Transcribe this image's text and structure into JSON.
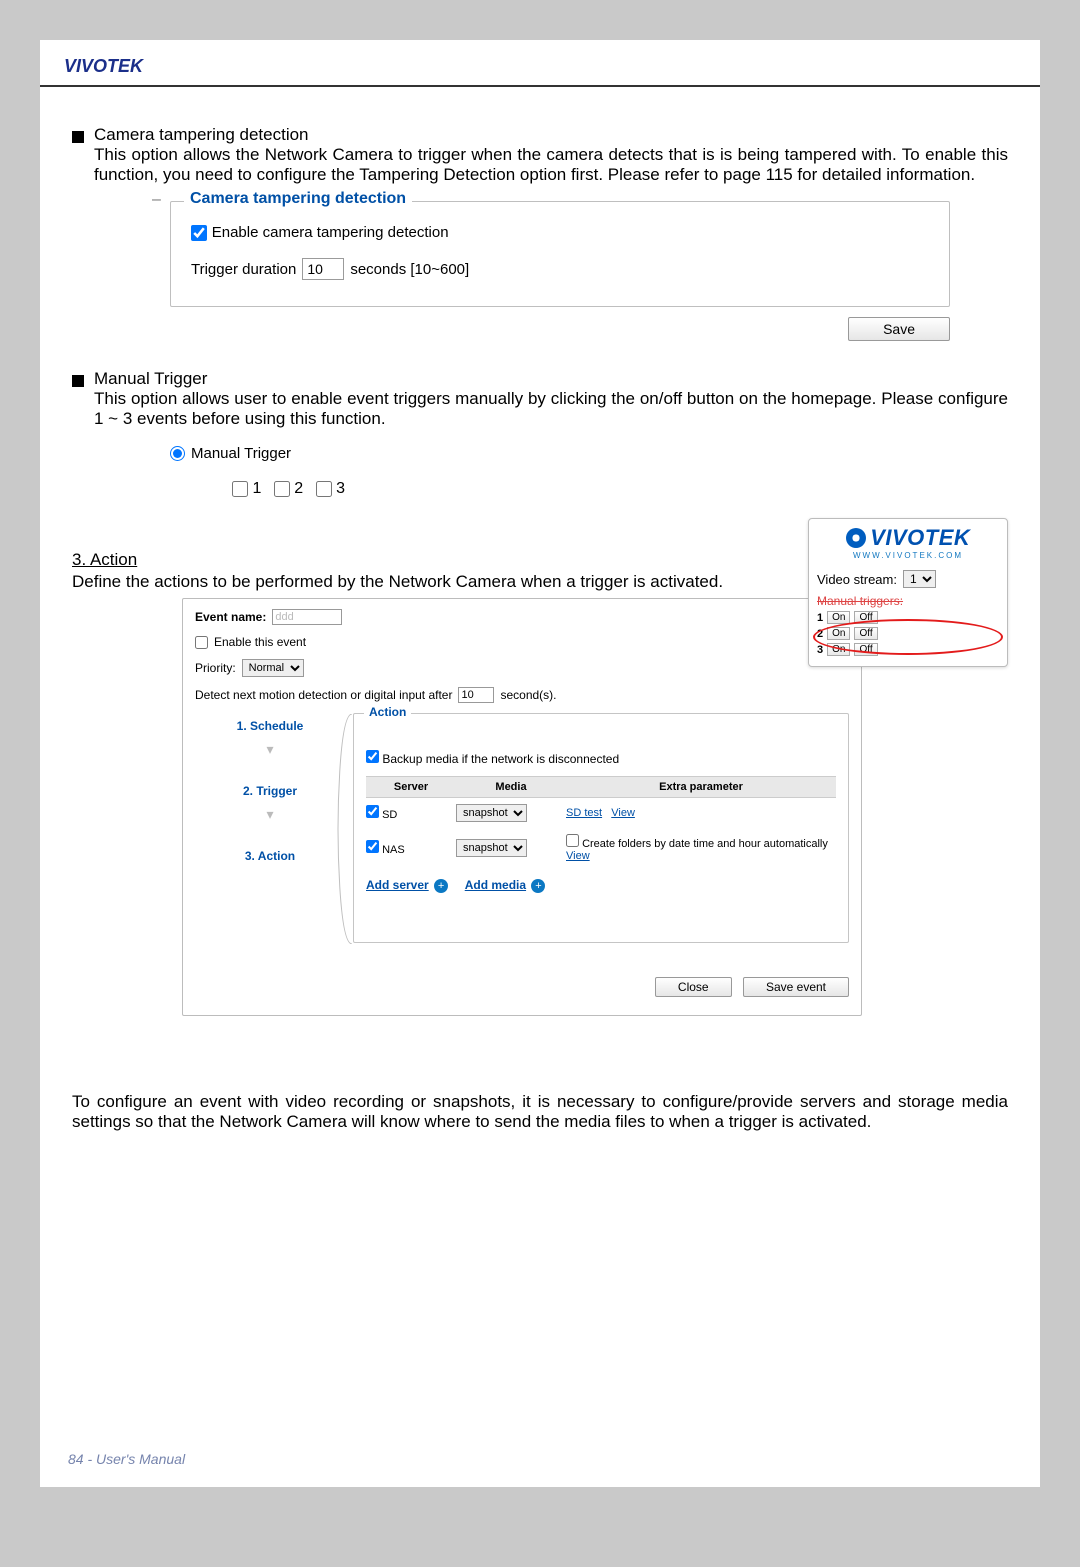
{
  "brand": "VIVOTEK",
  "section1": {
    "title": "Camera tampering detection",
    "body": "This option allows the Network Camera to trigger when the camera detects that is is being tampered with. To enable this function, you need to configure the Tampering Detection option first. Please refer to page 115 for detailed information."
  },
  "tampering_panel": {
    "legend": "Camera tampering detection",
    "enable_label": "Enable camera tampering detection",
    "enable_checked": true,
    "trigger_label": "Trigger duration",
    "trigger_value": "10",
    "trigger_suffix": "seconds [10~600]",
    "save_label": "Save"
  },
  "section2": {
    "title": "Manual Trigger",
    "body": "This option allows user to enable event triggers manually by clicking the on/off button on the homepage. Please configure 1 ~ 3 events before using this function."
  },
  "manual_trigger_panel": {
    "radio_label": "Manual Trigger",
    "opt1": "1",
    "opt2": "2",
    "opt3": "3"
  },
  "video_widget": {
    "logo": "VIVOTEK",
    "sub": "WWW.VIVOTEK.COM",
    "video_stream_label": "Video stream:",
    "video_stream_value": "1",
    "manual_triggers_label": "Manual triggers:",
    "rows": [
      {
        "n": "1",
        "on": "On",
        "off": "Off"
      },
      {
        "n": "2",
        "on": "On",
        "off": "Off"
      },
      {
        "n": "3",
        "on": "On",
        "off": "Off"
      }
    ]
  },
  "action_heading": "3. Action",
  "action_body": "Define the actions to be performed by the Network Camera when a trigger is activated.",
  "dlg": {
    "event_name_label": "Event name:",
    "event_name_value": "ddd",
    "enable_event_label": "Enable this event",
    "priority_label": "Priority:",
    "priority_value": "Normal",
    "detect_label_pre": "Detect next motion detection or digital input after",
    "detect_value": "10",
    "detect_label_post": "second(s).",
    "steps": {
      "s1": "1.  Schedule",
      "s2": "2.  Trigger",
      "s3": "3.  Action"
    },
    "action_legend": "Action",
    "backup_label": "Backup media if the network is disconnected",
    "table": {
      "h1": "Server",
      "h2": "Media",
      "h3": "Extra parameter",
      "row1": {
        "server": "SD",
        "media": "snapshot",
        "link1": "SD test",
        "link2": "View"
      },
      "row2": {
        "server": "NAS",
        "media": "snapshot",
        "extra_chk_label": "Create folders by date time and hour automatically",
        "link": "View"
      }
    },
    "add_server": "Add server",
    "add_media": "Add media",
    "close": "Close",
    "save_event": "Save event"
  },
  "note": "To configure an event with video recording or snapshots, it is necessary to configure/provide servers and storage media settings so that the Network Camera will know where to send the media files to when a trigger is activated.",
  "footer": "84 - User's Manual"
}
